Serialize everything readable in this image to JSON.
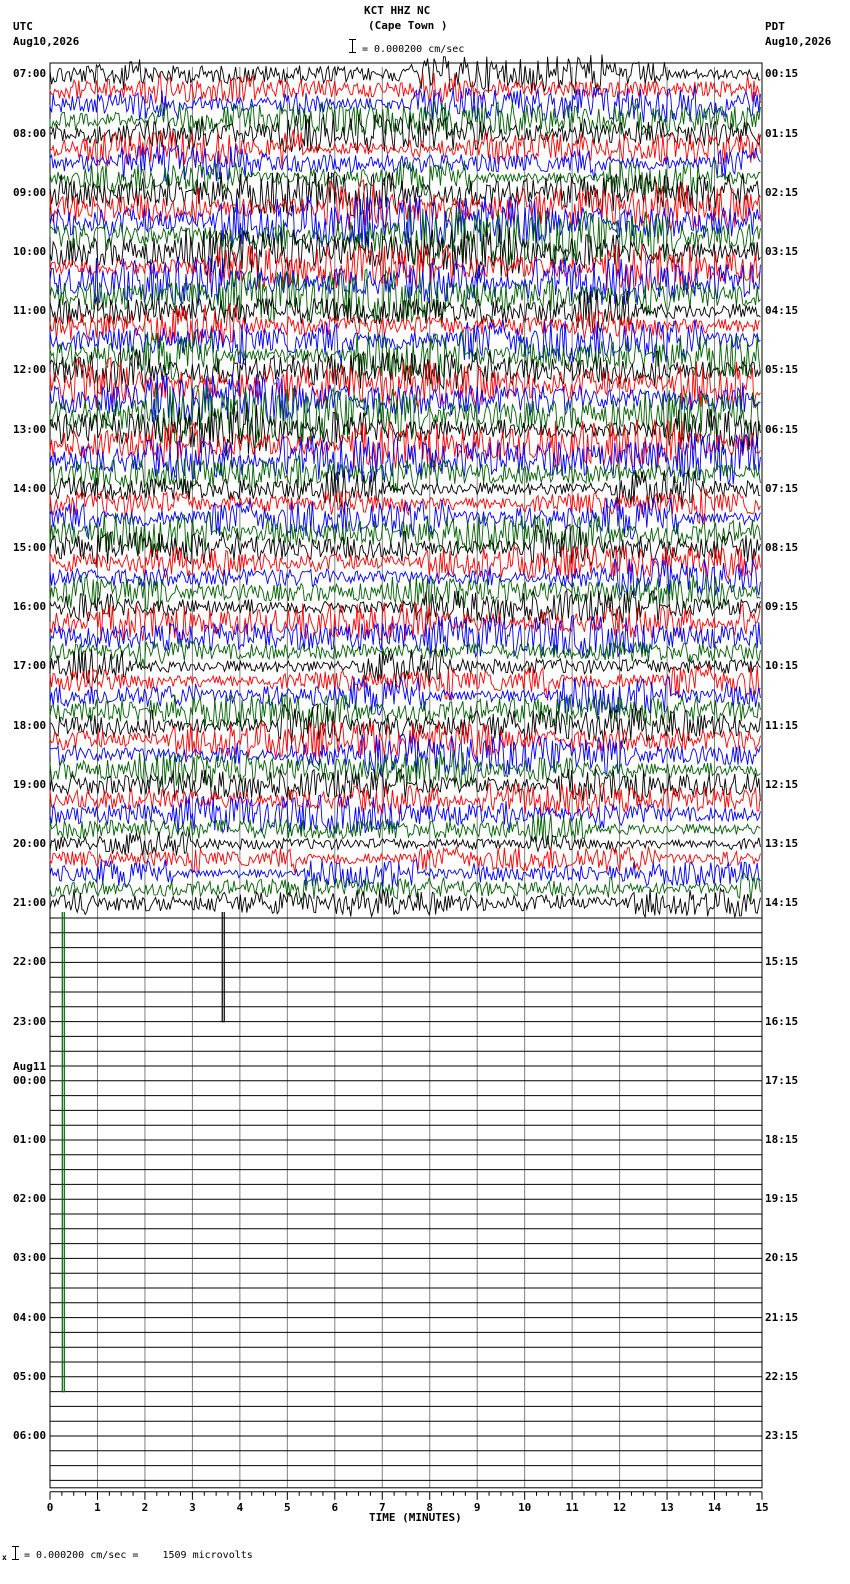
{
  "header": {
    "station": "KCT HHZ NC",
    "location": "(Cape Town )",
    "scale": "= 0.000200 cm/sec",
    "left_tz": "UTC",
    "left_date": "Aug10,2026",
    "right_tz": "PDT",
    "right_date": "Aug10,2026"
  },
  "footer": {
    "scale_note": "= 0.000200 cm/sec =    1509 microvolts",
    "corner_mark": "x"
  },
  "chart_data": {
    "type": "line",
    "title": "KCT HHZ NC (Cape Town )",
    "xlabel": "TIME (MINUTES)",
    "xlim": [
      0,
      15
    ],
    "x_ticks": [
      "0",
      "1",
      "2",
      "3",
      "4",
      "5",
      "6",
      "7",
      "8",
      "9",
      "10",
      "11",
      "12",
      "13",
      "14",
      "15"
    ],
    "rows_per_hour": 4,
    "total_rows": 96,
    "left_hour_labels": [
      "07:00",
      "08:00",
      "09:00",
      "10:00",
      "11:00",
      "12:00",
      "13:00",
      "14:00",
      "15:00",
      "16:00",
      "17:00",
      "18:00",
      "19:00",
      "20:00",
      "21:00",
      "22:00",
      "23:00",
      "00:00",
      "01:00",
      "02:00",
      "03:00",
      "04:00",
      "05:00",
      "06:00"
    ],
    "date_change_label": "Aug11",
    "date_change_hour_index": 17,
    "right_hour_labels": [
      "00:15",
      "01:15",
      "02:15",
      "03:15",
      "04:15",
      "05:15",
      "06:15",
      "07:15",
      "08:15",
      "09:15",
      "10:15",
      "11:15",
      "12:15",
      "13:15",
      "14:15",
      "15:15",
      "16:15",
      "17:15",
      "18:15",
      "19:15",
      "20:15",
      "21:15",
      "22:15",
      "23:15"
    ],
    "trace_colors": [
      "#000000",
      "#ff0000",
      "#0000ff",
      "#006400"
    ],
    "active_rows": 57,
    "events": [
      {
        "row": 57,
        "minute": 3.65,
        "direction": "down",
        "rows_spanned": 7
      },
      {
        "row": 57,
        "minute": 0.28,
        "direction": "down",
        "rows_spanned": 32
      }
    ]
  }
}
